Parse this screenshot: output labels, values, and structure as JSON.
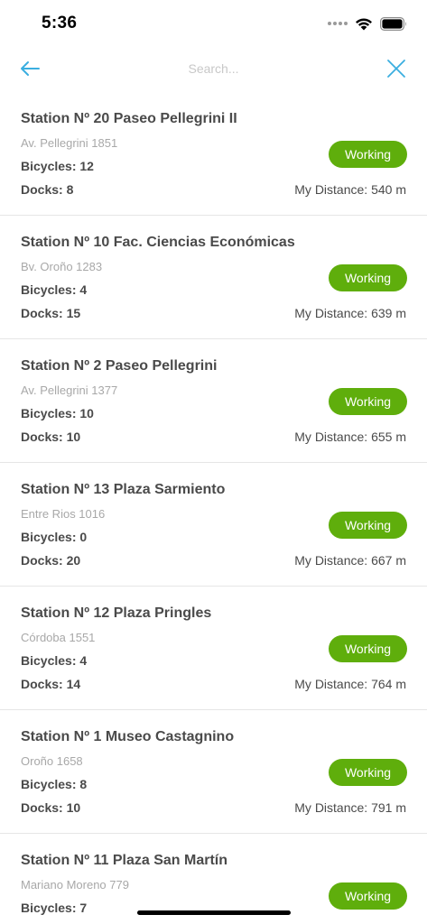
{
  "status_bar": {
    "time": "5:36"
  },
  "nav": {
    "search_placeholder": "Search..."
  },
  "labels": {
    "bicycles": "Bicycles:",
    "docks": "Docks:",
    "distance": "My Distance:"
  },
  "colors": {
    "accent": "#3aaee0",
    "working_badge": "#5fae0c",
    "address_gray": "#a8a8a8"
  },
  "stations": [
    {
      "name": "Station Nº 20 Paseo Pellegrini II",
      "address": "Av. Pellegrini 1851",
      "bicycles": "12",
      "docks": "8",
      "status": "Working",
      "distance": "540 m"
    },
    {
      "name": "Station Nº 10 Fac. Ciencias Económicas",
      "address": "Bv. Oroño 1283",
      "bicycles": "4",
      "docks": "15",
      "status": "Working",
      "distance": "639 m"
    },
    {
      "name": "Station Nº 2 Paseo Pellegrini",
      "address": "Av. Pellegrini 1377",
      "bicycles": "10",
      "docks": "10",
      "status": "Working",
      "distance": "655 m"
    },
    {
      "name": "Station Nº 13 Plaza Sarmiento",
      "address": "Entre Rios 1016",
      "bicycles": "0",
      "docks": "20",
      "status": "Working",
      "distance": "667 m"
    },
    {
      "name": "Station Nº 12 Plaza Pringles",
      "address": "Córdoba 1551",
      "bicycles": "4",
      "docks": "14",
      "status": "Working",
      "distance": "764 m"
    },
    {
      "name": "Station Nº 1 Museo Castagnino",
      "address": "Oroño 1658",
      "bicycles": "8",
      "docks": "10",
      "status": "Working",
      "distance": "791 m"
    },
    {
      "name": "Station Nº 11 Plaza San Martín",
      "address": "Mariano Moreno 779",
      "bicycles": "7",
      "status": "Working"
    }
  ]
}
